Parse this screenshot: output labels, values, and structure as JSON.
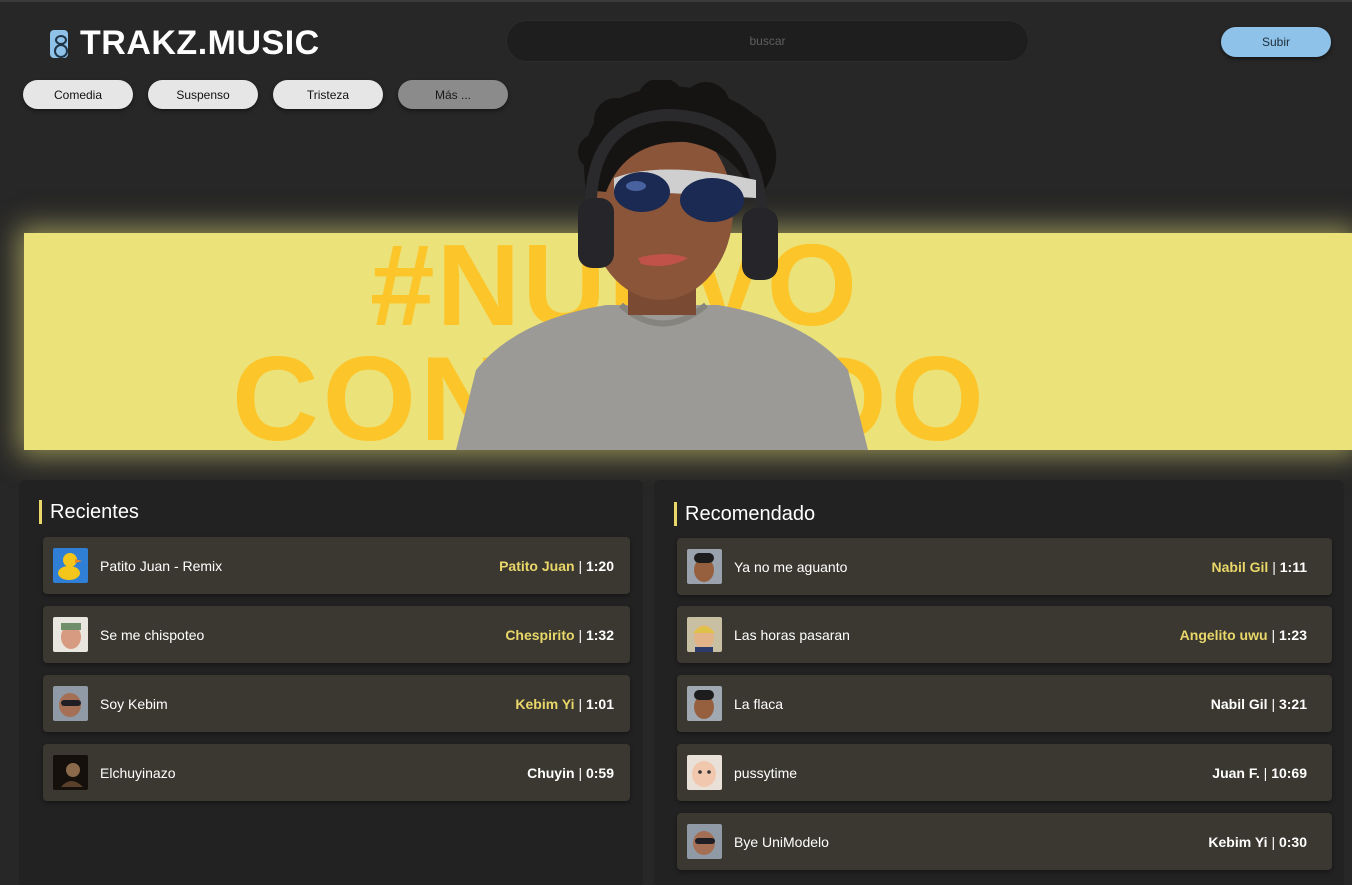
{
  "brand": {
    "name": "TRAKZ.MUSIC",
    "icon": "speaker-icon",
    "accent": "#8fc2e8"
  },
  "search": {
    "placeholder": "buscar"
  },
  "upload_label": "Subir",
  "genres": [
    "Comedia",
    "Suspenso",
    "Tristeza",
    "Más ..."
  ],
  "banner": {
    "line1": "#NUEVO",
    "line2": "CONTENIDO",
    "bg": "#ebe27a",
    "text_color": "#fcc52a"
  },
  "recientes": {
    "title": "Recientes",
    "items": [
      {
        "track": "Patito Juan - Remix",
        "artist": "Patito Juan",
        "duration": "1:20"
      },
      {
        "track": "Se me chispoteo",
        "artist": "Chespirito",
        "duration": "1:32"
      },
      {
        "track": "Soy Kebim",
        "artist": "Kebim Yi",
        "duration": "1:01"
      },
      {
        "track": "Elchuyinazo",
        "artist": "Chuyin",
        "duration": "0:59"
      }
    ]
  },
  "recomendado": {
    "title": "Recomendado",
    "items": [
      {
        "track": "Ya no me aguanto",
        "artist": "Nabil Gil",
        "duration": "1:11"
      },
      {
        "track": "Las horas pasaran",
        "artist": "Angelito uwu",
        "duration": "1:23"
      },
      {
        "track": "La flaca",
        "artist": "Nabil Gil",
        "duration": "3:21"
      },
      {
        "track": "pussytime",
        "artist": "Juan F.",
        "duration": "10:69"
      },
      {
        "track": "Bye UniModelo",
        "artist": "Kebim Yi",
        "duration": "0:30"
      }
    ]
  }
}
